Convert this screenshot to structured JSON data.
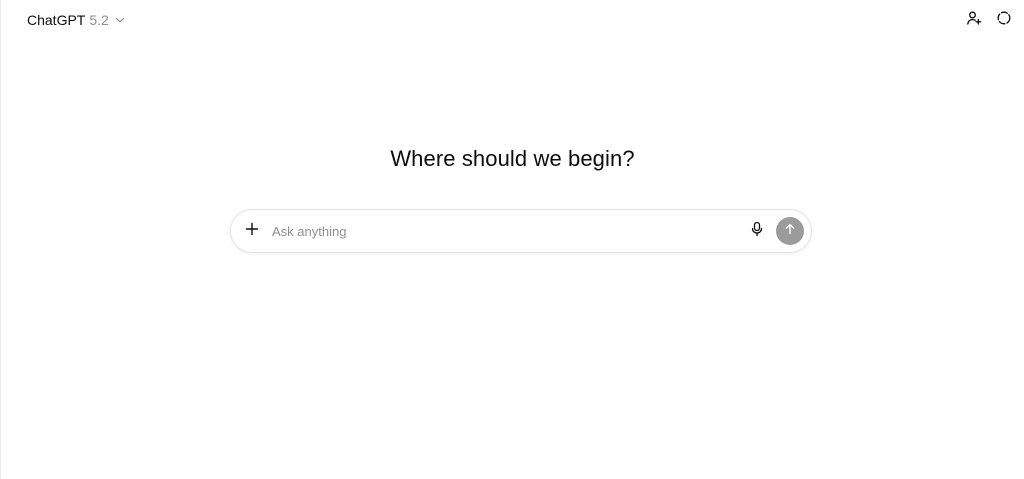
{
  "header": {
    "model_name": "ChatGPT",
    "model_version": "5.2",
    "icons": {
      "chevron": "chevron-down-icon",
      "add_people": "add-person-icon",
      "temporary_chat": "dashed-circle-icon"
    }
  },
  "main": {
    "heading": "Where should we begin?"
  },
  "composer": {
    "placeholder": "Ask anything",
    "value": "",
    "icons": {
      "plus": "plus-icon",
      "mic": "microphone-icon",
      "send": "arrow-up-icon"
    },
    "send_button_color": "#9b9b9b"
  },
  "colors": {
    "background": "#ffffff",
    "text": "#0d0d0d",
    "muted": "#8f8f8f"
  }
}
